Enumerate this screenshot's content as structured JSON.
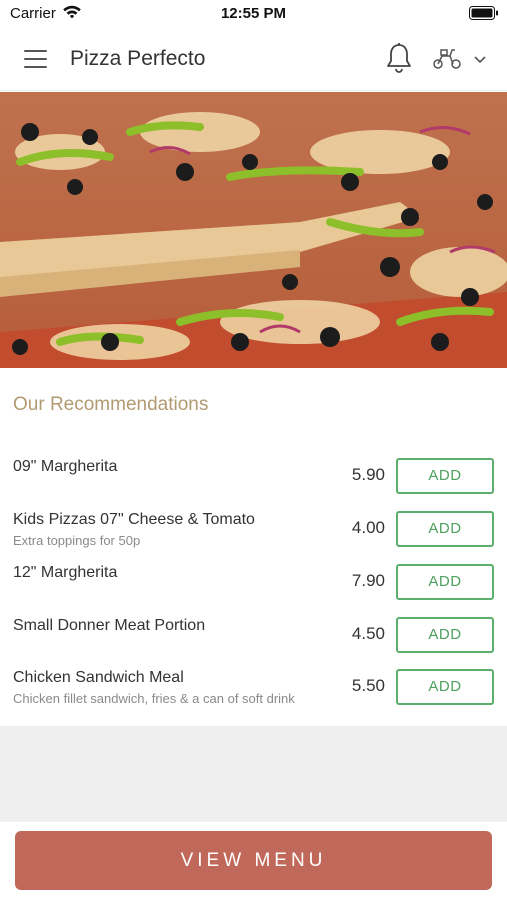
{
  "status_bar": {
    "carrier": "Carrier",
    "time": "12:55 PM"
  },
  "header": {
    "title": "Pizza Perfecto",
    "icons": [
      "menu-icon",
      "bell-icon",
      "scooter-icon",
      "chevron-down-icon"
    ]
  },
  "hero": {
    "image": "pizza-photo"
  },
  "recommendations": {
    "title": "Our Recommendations",
    "items": [
      {
        "name": "09\" Margherita",
        "description": "",
        "price": "5.90",
        "button": "ADD"
      },
      {
        "name": "Kids Pizzas 07\" Cheese & Tomato",
        "description": "Extra toppings for 50p",
        "price": "4.00",
        "button": "ADD"
      },
      {
        "name": "12\" Margherita",
        "description": "",
        "price": "7.90",
        "button": "ADD"
      },
      {
        "name": "Small Donner Meat Portion",
        "description": "",
        "price": "4.50",
        "button": "ADD"
      },
      {
        "name": "Chicken Sandwich Meal",
        "description": "Chicken fillet sandwich, fries & a can of soft drink",
        "price": "5.50",
        "button": "ADD"
      }
    ]
  },
  "footer": {
    "button": "VIEW MENU"
  },
  "colors": {
    "accent_button": "#c0685a",
    "add_border": "#5cae6c",
    "section_title": "#b29a73"
  }
}
